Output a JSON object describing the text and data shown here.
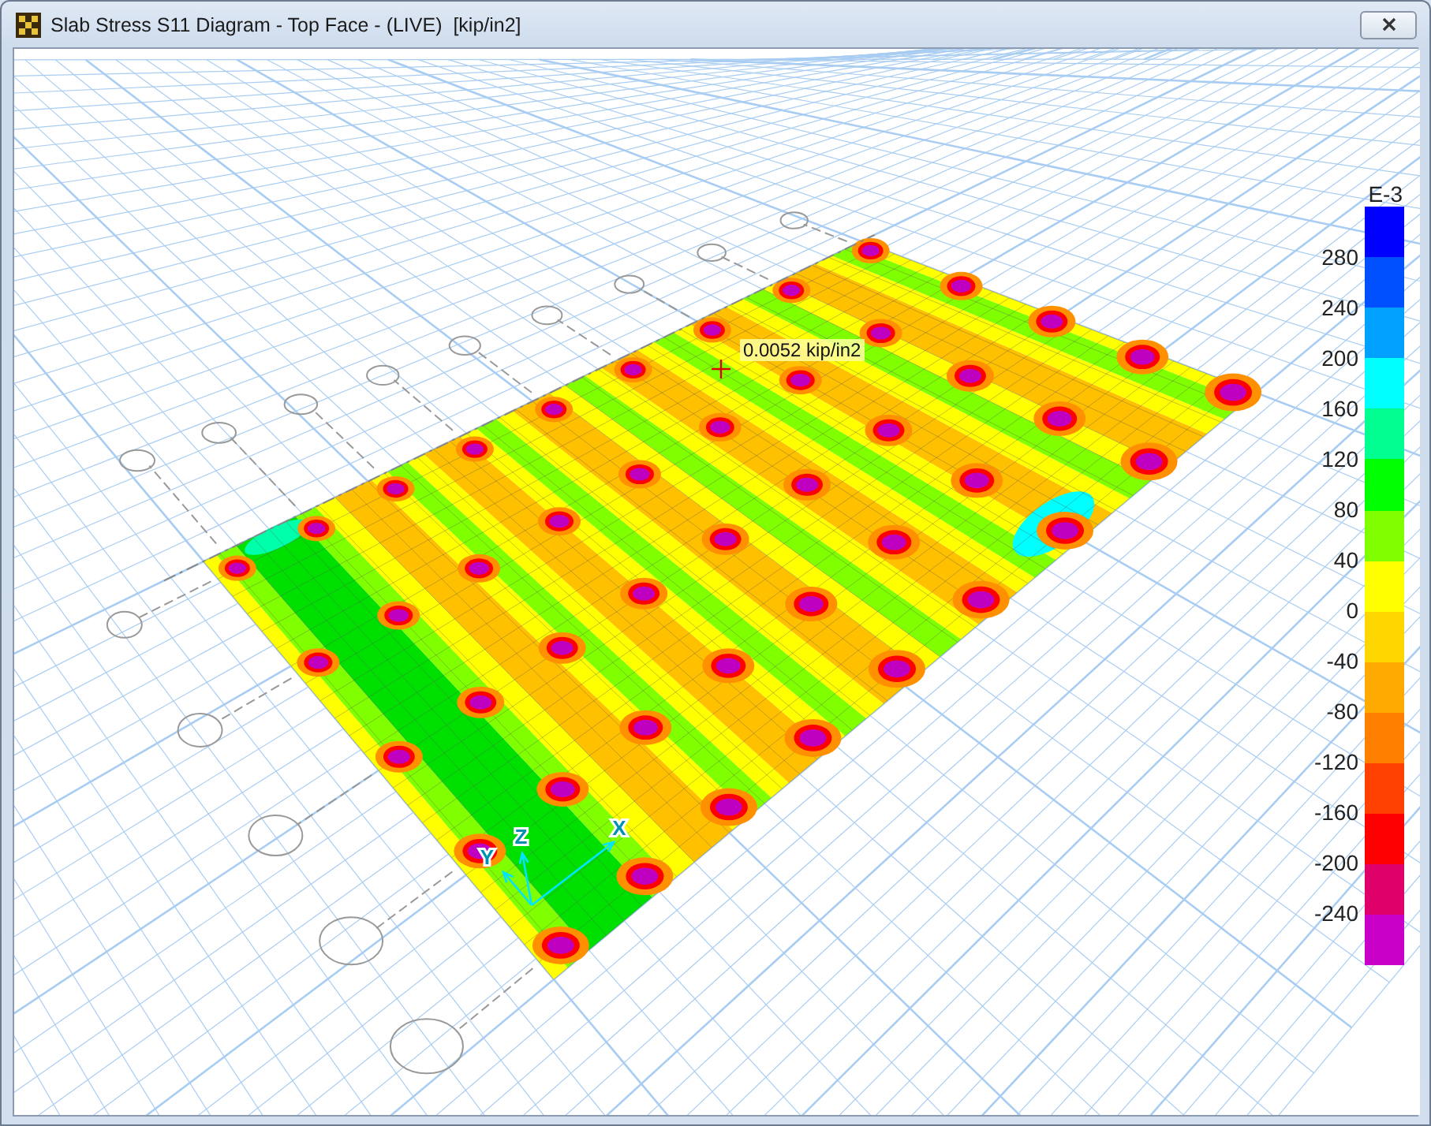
{
  "window": {
    "title": "Slab Stress S11 Diagram - Top Face - (LIVE)  [kip/in2]"
  },
  "view": {
    "point_label": "0.0052 kip/in2",
    "axes": [
      {
        "kind": "x",
        "label": "X"
      },
      {
        "kind": "y",
        "label": "Y"
      },
      {
        "kind": "z",
        "label": "Z"
      }
    ]
  },
  "legend": {
    "exponent": "E-3",
    "bands": [
      {
        "color": "#0000ff"
      },
      {
        "color": "#0050ff"
      },
      {
        "color": "#00a0ff"
      },
      {
        "color": "#00ffff"
      },
      {
        "color": "#00ff90"
      },
      {
        "color": "#00ff00"
      },
      {
        "color": "#80ff00"
      },
      {
        "color": "#ffff00"
      },
      {
        "color": "#ffd700"
      },
      {
        "color": "#ffaa00"
      },
      {
        "color": "#ff8000"
      },
      {
        "color": "#ff4000"
      },
      {
        "color": "#ff0000"
      },
      {
        "color": "#e0006a"
      },
      {
        "color": "#c800c8"
      }
    ],
    "ticks": [
      "280",
      "240",
      "200",
      "160",
      "120",
      "80",
      "40",
      "0",
      "-40",
      "-80",
      "-120",
      "-160",
      "-200",
      "-240"
    ]
  }
}
